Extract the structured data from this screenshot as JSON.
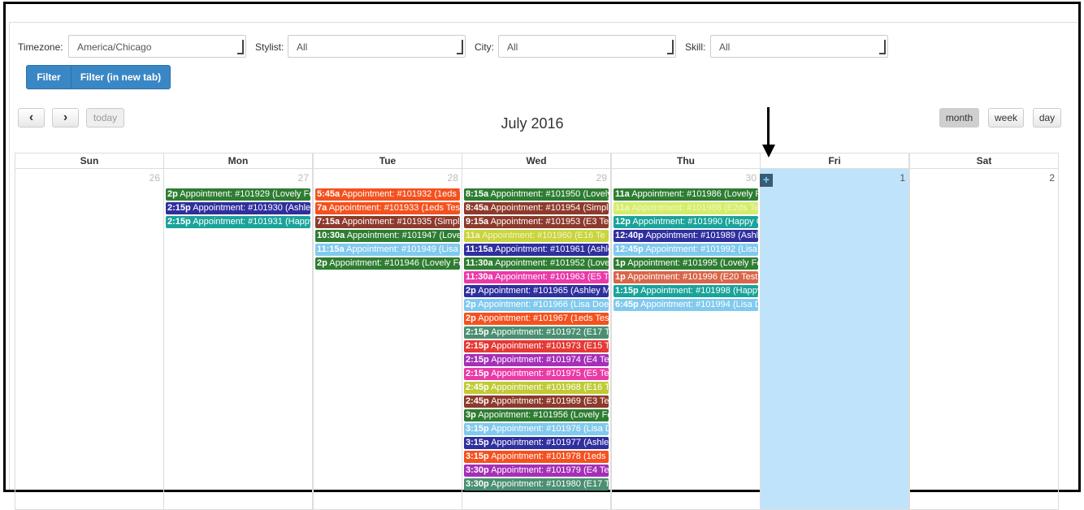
{
  "filters": {
    "timezone_label": "Timezone:",
    "timezone_value": "America/Chicago",
    "stylist_label": "Stylist:",
    "stylist_value": "All",
    "city_label": "City:",
    "city_value": "All",
    "skill_label": "Skill:",
    "skill_value": "All",
    "filter_btn": "Filter",
    "filter_newtab_btn": "Filter (in new tab)"
  },
  "toolbar": {
    "prev": "‹",
    "next": "›",
    "today": "today",
    "title": "July 2016",
    "month": "month",
    "week": "week",
    "day": "day"
  },
  "calendar": {
    "headers": [
      "Sun",
      "Mon",
      "Tue",
      "Wed",
      "Thu",
      "Fri",
      "Sat"
    ],
    "days": [
      {
        "num": "26",
        "prev": true,
        "events": []
      },
      {
        "num": "27",
        "prev": true,
        "events": [
          {
            "time": "2p",
            "text": "Appointment: #101929 (Lovely Fo",
            "color": "#2e7d32"
          },
          {
            "time": "2:15p",
            "text": "Appointment: #101930 (Ashley",
            "color": "#2f2f9e"
          },
          {
            "time": "2:15p",
            "text": "Appointment: #101931 (Happy",
            "color": "#1aa39a"
          }
        ]
      },
      {
        "num": "28",
        "prev": true,
        "events": [
          {
            "time": "5:45a",
            "text": "Appointment: #101932 (1eds T",
            "color": "#f4511e"
          },
          {
            "time": "7a",
            "text": "Appointment: #101933 (1eds Test",
            "color": "#f4511e"
          },
          {
            "time": "7:15a",
            "text": "Appointment: #101935 (Simple",
            "color": "#8d3a2c"
          },
          {
            "time": "10:30a",
            "text": "Appointment: #101947 (Lovel",
            "color": "#2e7d32"
          },
          {
            "time": "11:15a",
            "text": "Appointment: #101949 (Lisa D",
            "color": "#81c9ee"
          },
          {
            "time": "2p",
            "text": "Appointment: #101946 (Lovely Fo",
            "color": "#2e7d32"
          }
        ]
      },
      {
        "num": "29",
        "prev": true,
        "events": [
          {
            "time": "8:15a",
            "text": "Appointment: #101950 (Lovely",
            "color": "#2e7d32"
          },
          {
            "time": "8:45a",
            "text": "Appointment: #101954 (Simple",
            "color": "#8d3a2c"
          },
          {
            "time": "9:15a",
            "text": "Appointment: #101953 (E3 Test",
            "color": "#8d3a2c"
          },
          {
            "time": "11a",
            "text": "Appointment: #101960 (E16 Te",
            "color": "#c8d53f"
          },
          {
            "time": "11:15a",
            "text": "Appointment: #101961 (Ashle",
            "color": "#2f2f9e"
          },
          {
            "time": "11:30a",
            "text": "Appointment: #101952 (Lovel",
            "color": "#2e7d32"
          },
          {
            "time": "11:30a",
            "text": "Appointment: #101963 (E5 Te",
            "color": "#ea3aa8"
          },
          {
            "time": "2p",
            "text": "Appointment: #101965 (Ashley Ma",
            "color": "#2f2f9e"
          },
          {
            "time": "2p",
            "text": "Appointment: #101966 (Lisa Doe)",
            "color": "#81c9ee"
          },
          {
            "time": "2p",
            "text": "Appointment: #101967 (1eds Test",
            "color": "#f4511e"
          },
          {
            "time": "2:15p",
            "text": "Appointment: #101972 (E17 Te",
            "color": "#4a8f72"
          },
          {
            "time": "2:15p",
            "text": "Appointment: #101973 (E15 Te",
            "color": "#e53935"
          },
          {
            "time": "2:15p",
            "text": "Appointment: #101974 (E4 Tes",
            "color": "#a52fb8"
          },
          {
            "time": "2:15p",
            "text": "Appointment: #101975 (E5 Tes",
            "color": "#ea3aa8"
          },
          {
            "time": "2:45p",
            "text": "Appointment: #101968 (E16 Te",
            "color": "#c0ca33"
          },
          {
            "time": "2:45p",
            "text": "Appointment: #101969 (E3 Tes",
            "color": "#8d3a2c"
          },
          {
            "time": "3p",
            "text": "Appointment: #101956 (Lovely Fo",
            "color": "#2e7d32"
          },
          {
            "time": "3:15p",
            "text": "Appointment: #101976 (Lisa D",
            "color": "#81c9ee"
          },
          {
            "time": "3:15p",
            "text": "Appointment: #101977 (Ashley",
            "color": "#2f2f9e"
          },
          {
            "time": "3:15p",
            "text": "Appointment: #101978 (1eds T",
            "color": "#f4511e"
          },
          {
            "time": "3:30p",
            "text": "Appointment: #101979 (E4 Tes",
            "color": "#a52fb8"
          },
          {
            "time": "3:30p",
            "text": "Appointment: #101980 (E17 Te",
            "color": "#4a8f72"
          }
        ]
      },
      {
        "num": "30",
        "prev": true,
        "events": [
          {
            "time": "11a",
            "text": "Appointment: #101986 (Lovely F",
            "color": "#2e7d32"
          },
          {
            "time": "11a",
            "text": "Appointment: #101988 (E2ds Te",
            "color": "#d3ee6a"
          },
          {
            "time": "12p",
            "text": "Appointment: #101990 (Happy G",
            "color": "#1aa39a"
          },
          {
            "time": "12:40p",
            "text": "Appointment: #101989 (Ashle",
            "color": "#2f2f9e"
          },
          {
            "time": "12:45p",
            "text": "Appointment: #101992 (Lisa D",
            "color": "#81c9ee"
          },
          {
            "time": "1p",
            "text": "Appointment: #101995 (Lovely Fo",
            "color": "#2e7d32"
          },
          {
            "time": "1p",
            "text": "Appointment: #101996 (E20 Testi",
            "color": "#d8664a"
          },
          {
            "time": "1:15p",
            "text": "Appointment: #101998 (Happy",
            "color": "#1aa39a"
          },
          {
            "time": "6:45p",
            "text": "Appointment: #101994 (Lisa D",
            "color": "#81c9ee"
          }
        ]
      },
      {
        "num": "1",
        "prev": false,
        "today": true,
        "events": []
      },
      {
        "num": "2",
        "prev": false,
        "events": []
      }
    ]
  },
  "plus_icon": "+"
}
